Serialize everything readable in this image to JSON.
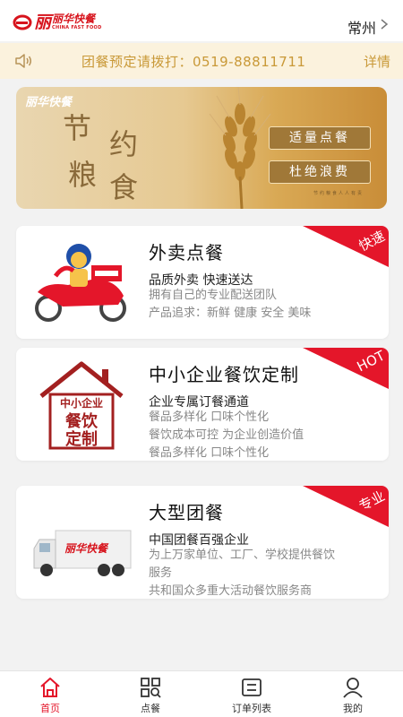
{
  "header": {
    "brand_cn": "丽华快餐",
    "brand_en": "CHINA FAST FOOD",
    "city": "常州"
  },
  "notice": {
    "text": "团餐预定请拨打：0519-88811711",
    "more": "详情"
  },
  "banner": {
    "logo": "丽华快餐",
    "chars": [
      "节",
      "约",
      "粮",
      "食"
    ],
    "pill1": "适量点餐",
    "pill2": "杜绝浪费",
    "tiny": "节约粮食人人有责"
  },
  "cards": [
    {
      "title": "外卖点餐",
      "sub": "品质外卖 快速送达",
      "desc": [
        "拥有自己的专业配送团队",
        "产品追求：新鲜 健康 安全 美味"
      ],
      "tag": "快速"
    },
    {
      "title": "中小企业餐饮定制",
      "sub": "企业专属订餐通道",
      "desc": [
        "餐品多样化 口味个性化",
        "餐饮成本可控 为企业创造价值",
        "餐品多样化 口味个性化"
      ],
      "tag": "HOT",
      "thumb_text": [
        "中小企业",
        "餐饮",
        "定制"
      ]
    },
    {
      "title": "大型团餐",
      "sub": "中国团餐百强企业",
      "desc": [
        "为上万家单位、工厂、学校提供餐饮",
        "服务",
        "共和国众多重大活动餐饮服务商"
      ],
      "tag": "专业",
      "truck_logo": "丽华快餐"
    }
  ],
  "tabs": [
    {
      "label": "首页",
      "icon": "home-icon",
      "active": true
    },
    {
      "label": "点餐",
      "icon": "grid-search-icon",
      "active": false
    },
    {
      "label": "订单列表",
      "icon": "order-list-icon",
      "active": false
    },
    {
      "label": "我的",
      "icon": "user-icon",
      "active": false
    }
  ],
  "colors": {
    "accent": "#e4162a",
    "notice_text": "#c99938",
    "notice_bg": "#fbf2dd"
  }
}
